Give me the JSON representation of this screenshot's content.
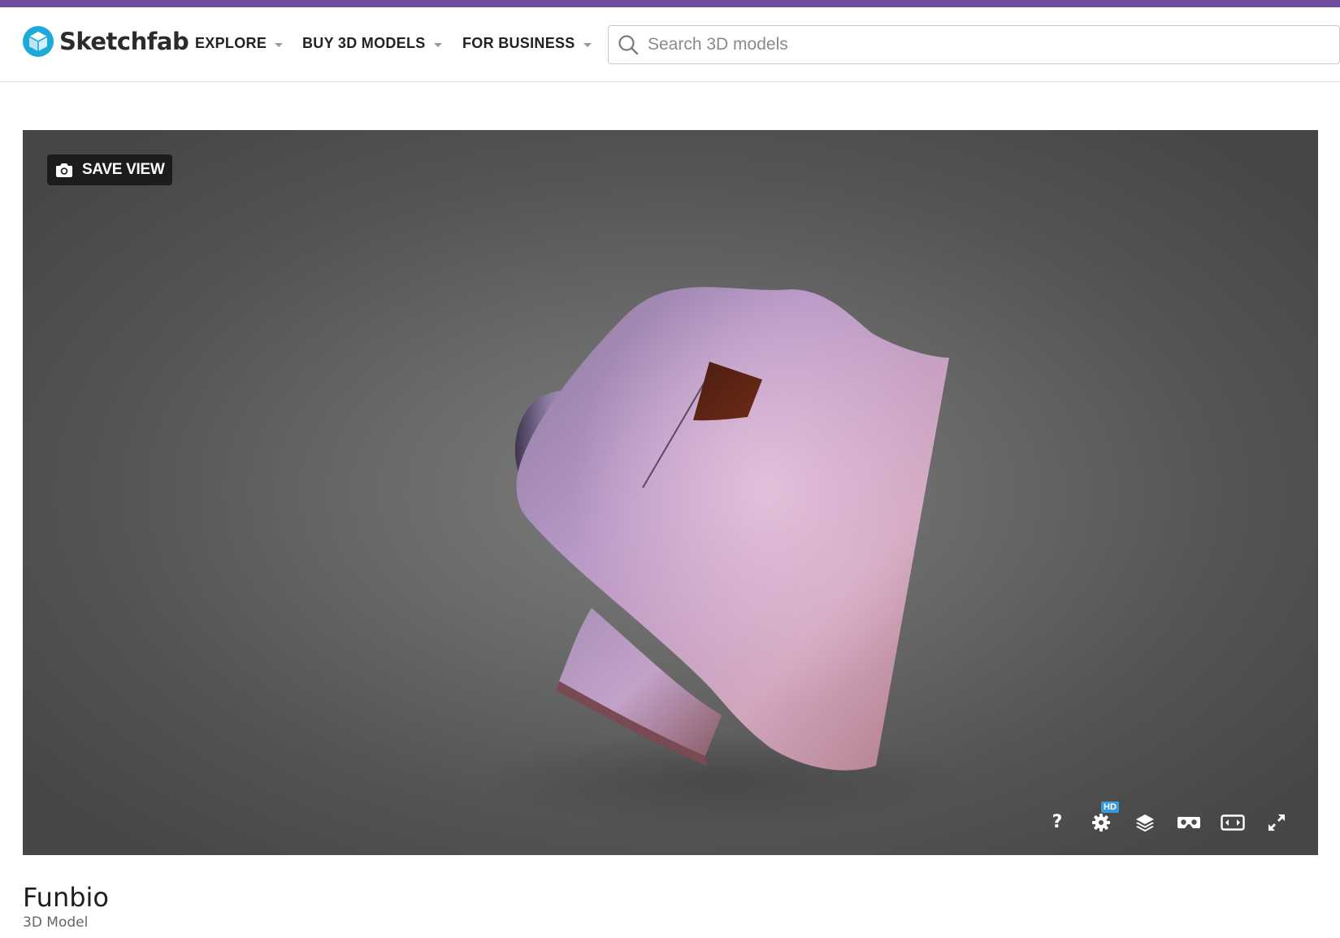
{
  "brand": {
    "name": "Sketchfab",
    "logo_icon": "sketchfab-cube-logo",
    "accent_color": "#6f4ea0",
    "logo_color": "#1caad9"
  },
  "nav": {
    "items": [
      {
        "label": "EXPLORE",
        "icon": "chevron-down-icon"
      },
      {
        "label": "BUY 3D MODELS",
        "icon": "chevron-down-icon"
      },
      {
        "label": "FOR BUSINESS",
        "icon": "chevron-down-icon"
      }
    ]
  },
  "search": {
    "placeholder": "Search 3D models",
    "value": "",
    "icon": "search-icon"
  },
  "viewer": {
    "save_view_label": "SAVE VIEW",
    "save_view_icon": "camera-icon",
    "controls": [
      {
        "name": "help",
        "glyph": "?",
        "icon": "help-icon"
      },
      {
        "name": "settings",
        "icon": "gear-icon",
        "badge": "HD"
      },
      {
        "name": "layers",
        "icon": "layers-icon"
      },
      {
        "name": "vr",
        "icon": "vr-headset-icon"
      },
      {
        "name": "embed",
        "icon": "widescreen-icon"
      },
      {
        "name": "fullscreen",
        "icon": "fullscreen-icon"
      }
    ],
    "badge_color": "#3a9ad9"
  },
  "model": {
    "title": "Funbio",
    "subtitle": "3D Model"
  }
}
